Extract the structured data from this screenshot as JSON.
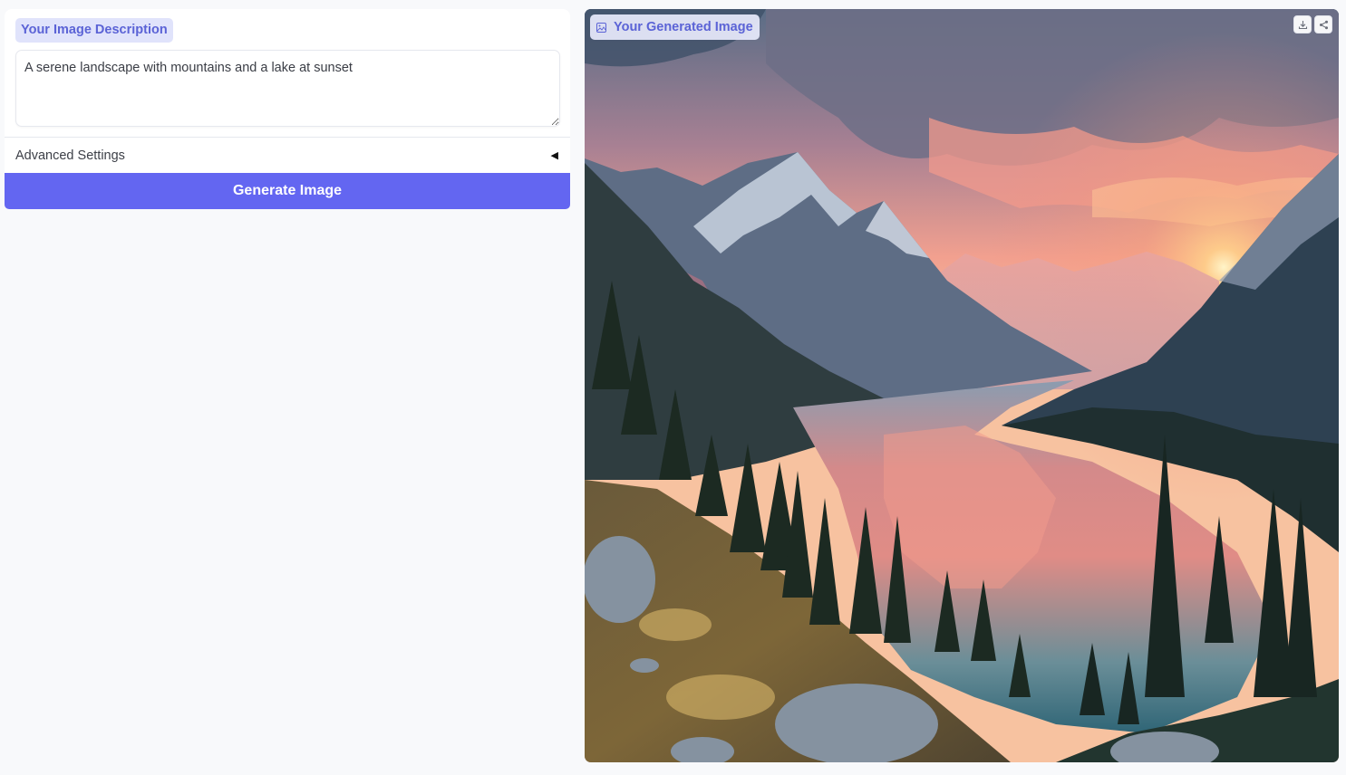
{
  "input_panel": {
    "label": "Your Image Description",
    "prompt_value": "A serene landscape with mountains and a lake at sunset",
    "advanced_label": "Advanced Settings",
    "advanced_arrow": "◀",
    "generate_label": "Generate Image"
  },
  "output_panel": {
    "label": "Your Generated Image",
    "label_icon": "image-icon",
    "actions": [
      "download-icon",
      "share-icon"
    ]
  },
  "colors": {
    "accent": "#6366f1",
    "label_bg": "#e0e3fb",
    "label_text": "#5b63d6",
    "page_bg": "#f8f9fb"
  }
}
